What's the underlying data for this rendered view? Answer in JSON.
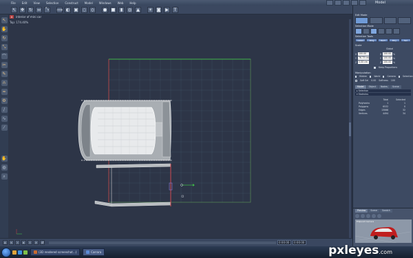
{
  "menu": [
    "File",
    "Edit",
    "View",
    "Selection",
    "Construct",
    "Model",
    "Windows",
    "Web",
    "Help"
  ],
  "workspace_label": "Model",
  "toolbar_icons": [
    "cursor-icon",
    "pan-icon",
    "rotate-icon",
    "move-icon",
    "scale-icon",
    "sweep-icon",
    "lathe-icon",
    "extrude-icon",
    "smooth-icon",
    "bevel-icon",
    "sphere-icon",
    "cube-icon",
    "cylinder-icon",
    "torus-icon",
    "cone-icon",
    "light-icon",
    "camera-icon",
    "render-icon",
    "text-icon"
  ],
  "viewport": {
    "title": "interior of mini car",
    "zoom": "Top: 174.40%"
  },
  "timeline": {
    "field1": "0:00:00",
    "field2": "0:00:00"
  },
  "right_panel": {
    "edit_mode": "Edit Mode",
    "selection_mode": "Selection Mode",
    "selection_tools": "Selection Tools",
    "tools": [
      "Lasso",
      "Ring",
      "Rect",
      "Poly",
      "Sel"
    ],
    "scale": "Scale",
    "global": "Global",
    "scale_rows": [
      {
        "axis": "X",
        "value": "100.00 cm",
        "pct": "100.00"
      },
      {
        "axis": "Y",
        "value": "76.73 cm",
        "pct": "100.00"
      },
      {
        "axis": "Z",
        "value": "0.00 cm",
        "pct": "100.00"
      }
    ],
    "keep_proportions": "Keep Proportions",
    "manipulation": "Manipulation",
    "manip_options": [
      "Hidden",
      "World",
      "Camera",
      "Selection"
    ],
    "soft_sel_label": "Soft Sel",
    "soft_sel_value": "0.00",
    "softness_label": "Softness",
    "softness_value": "100",
    "tabs": [
      "Model",
      "Object",
      "Nodes",
      "Scene"
    ],
    "sections": [
      "Selection",
      "Statistics"
    ],
    "stats_headers": [
      "",
      "Total",
      "Selected"
    ],
    "stats_rows": [
      [
        "Polyhedra",
        "1",
        "1"
      ],
      [
        "Polygons",
        "6532",
        "0"
      ],
      [
        "Edges",
        "13068",
        "32"
      ],
      [
        "Vertices",
        "4494",
        "34"
      ]
    ],
    "preview_tabs": [
      "Preview",
      "Scene",
      "Swatch"
    ],
    "preview_caption": "Ellipsoid Camera"
  },
  "taskbar": {
    "apps": [
      "(3D rendered screenshot...)",
      "Carrara"
    ]
  },
  "watermark": {
    "main": "pxleyes",
    "suffix": ".com"
  }
}
